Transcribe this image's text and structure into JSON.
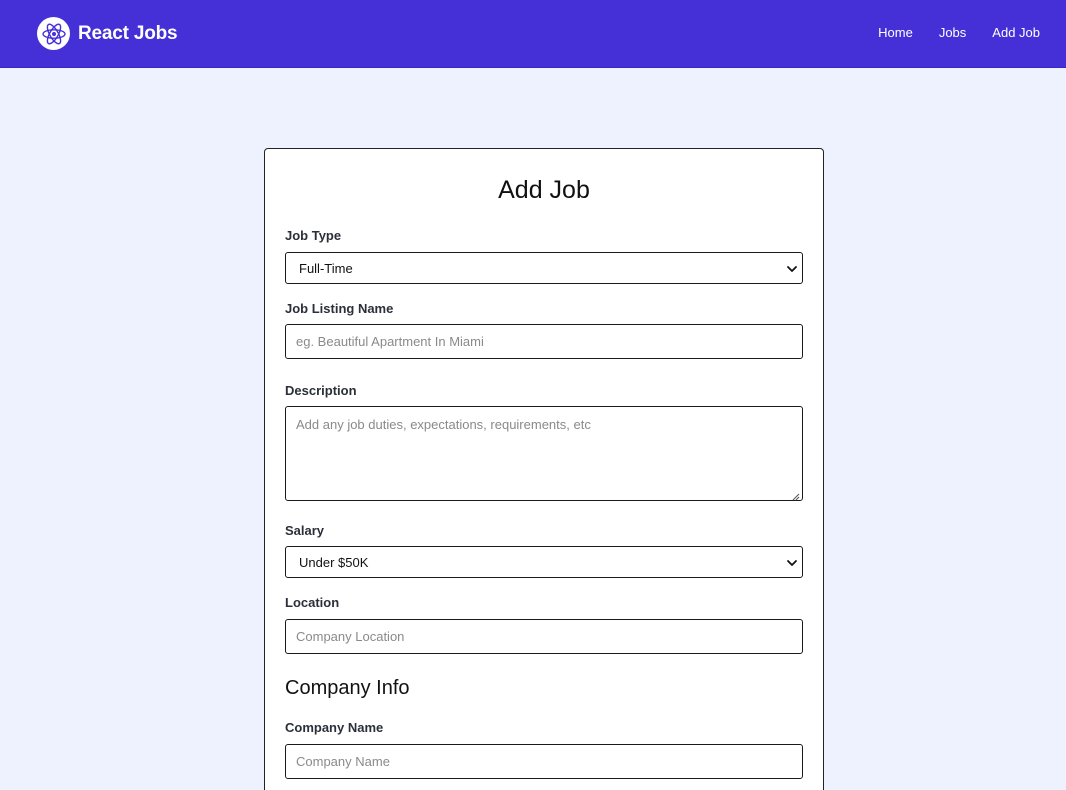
{
  "header": {
    "brand": "React Jobs",
    "logo_icon": "react-atom-icon",
    "nav": [
      {
        "label": "Home"
      },
      {
        "label": "Jobs"
      },
      {
        "label": "Add Job"
      }
    ]
  },
  "form": {
    "title": "Add Job",
    "job_type": {
      "label": "Job Type",
      "value": "Full-Time"
    },
    "listing_name": {
      "label": "Job Listing Name",
      "placeholder": "eg. Beautiful Apartment In Miami"
    },
    "description": {
      "label": "Description",
      "placeholder": "Add any job duties, expectations, requirements, etc"
    },
    "salary": {
      "label": "Salary",
      "value": "Under $50K"
    },
    "location": {
      "label": "Location",
      "placeholder": "Company Location"
    },
    "company_section": "Company Info",
    "company_name": {
      "label": "Company Name",
      "placeholder": "Company Name"
    }
  },
  "colors": {
    "navbar": "#4530d7",
    "page_background": "#eef2ff",
    "card_background": "#ffffff"
  }
}
